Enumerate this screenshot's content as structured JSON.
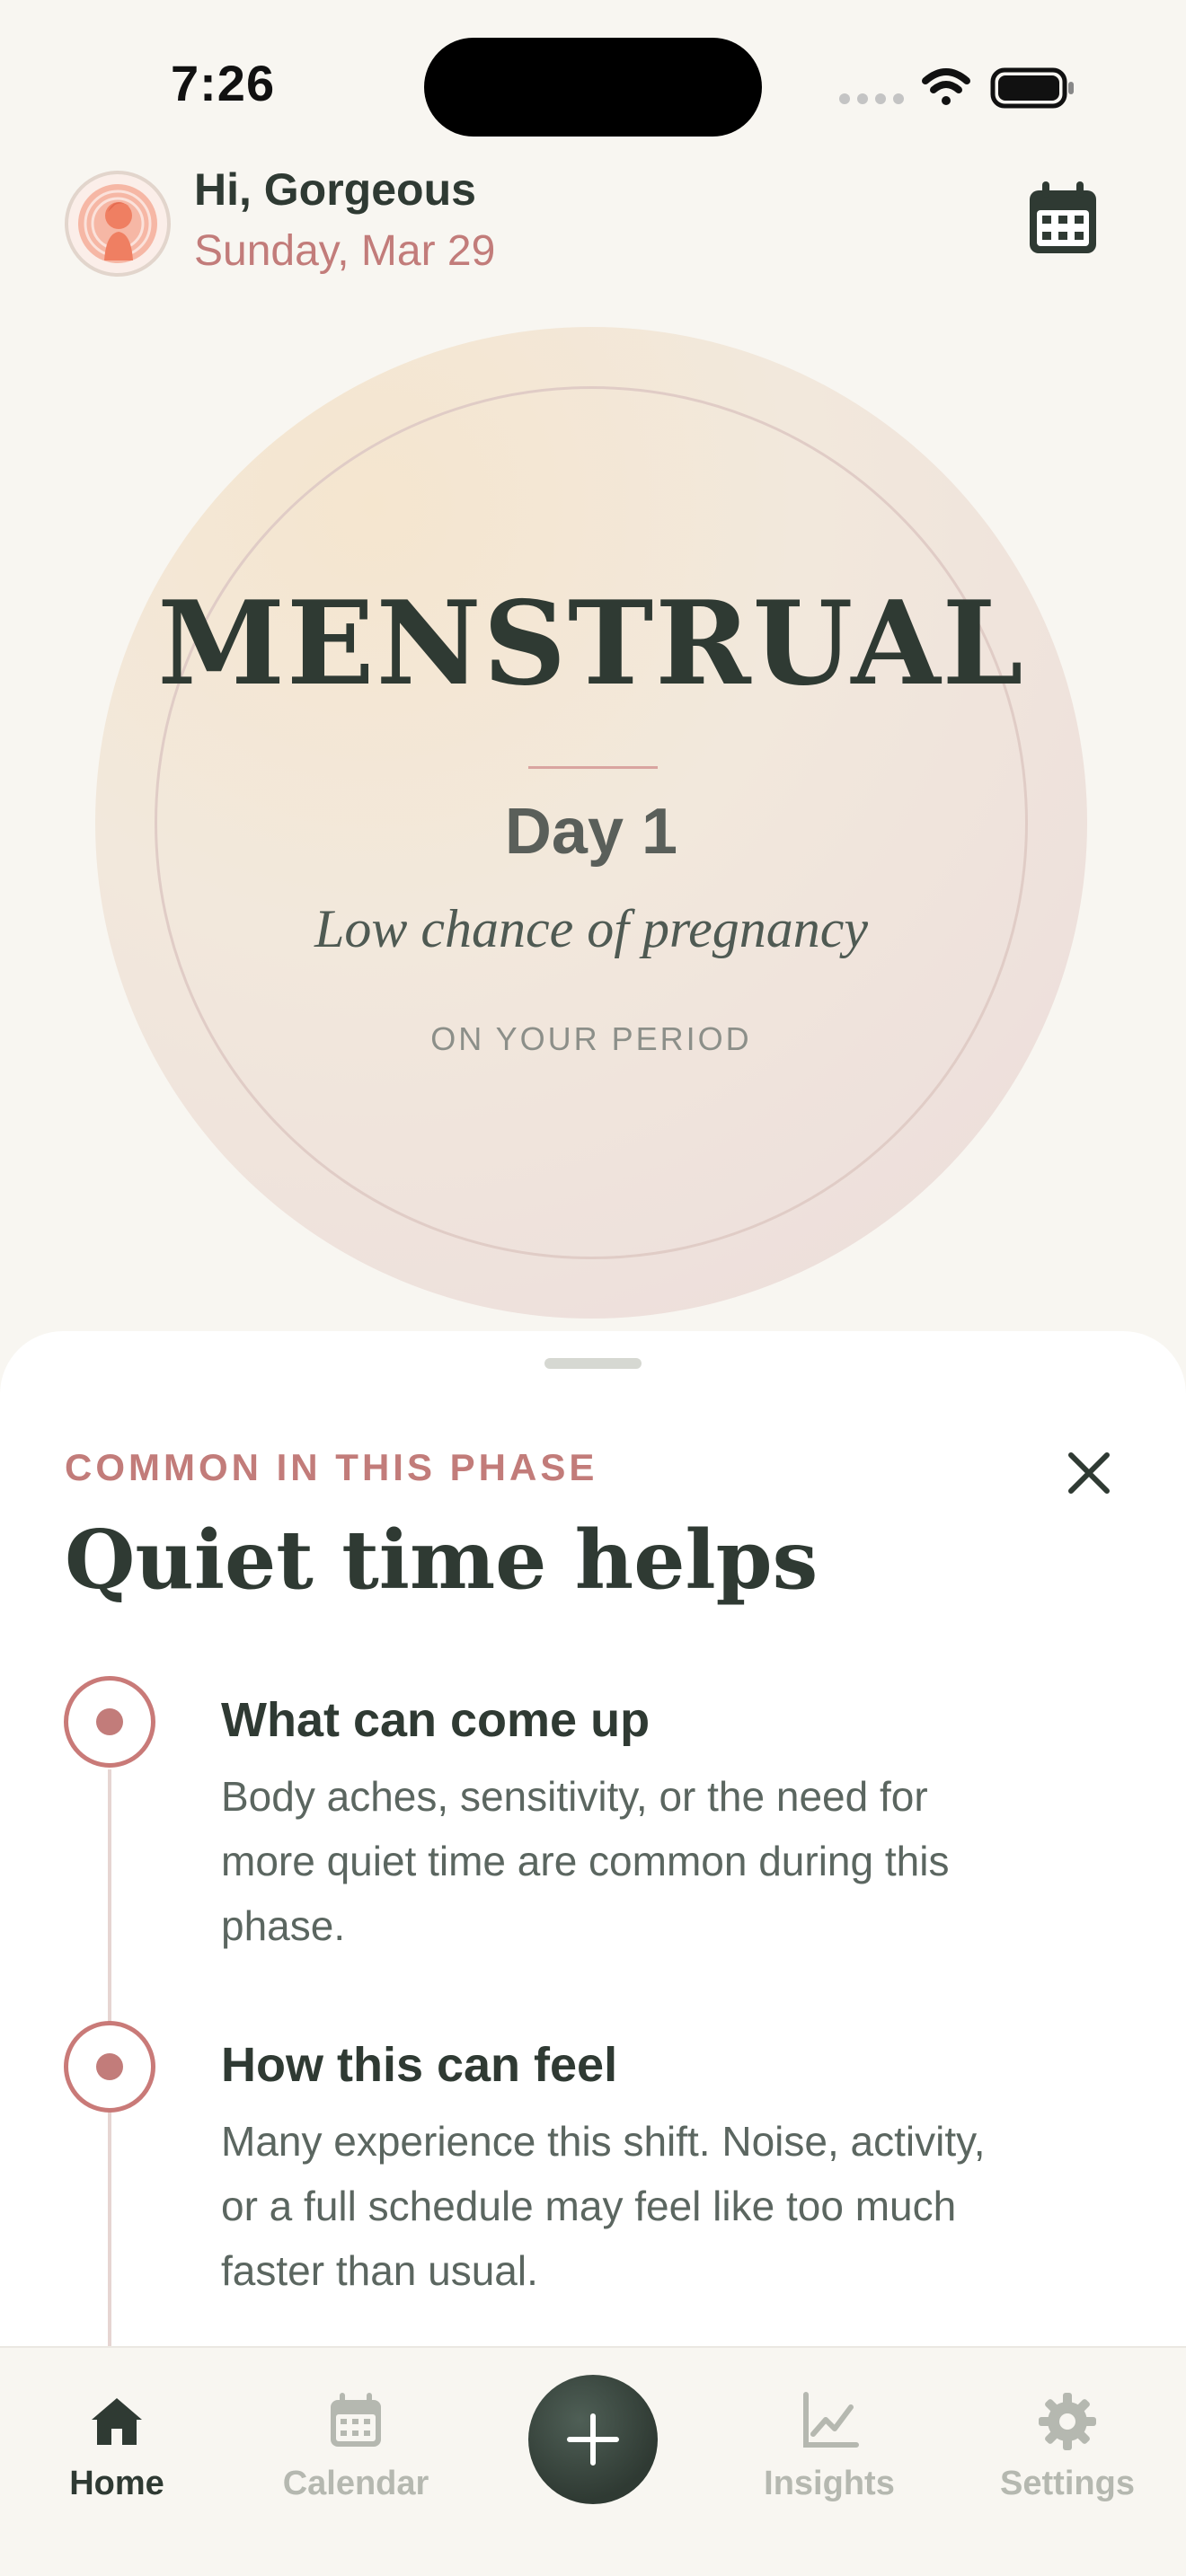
{
  "status_bar": {
    "time": "7:26"
  },
  "header": {
    "greeting": "Hi, Gorgeous",
    "date": "Sunday, Mar 29",
    "avatar_icon": "woman-silhouette-icon",
    "calendar_icon": "calendar-icon"
  },
  "hero": {
    "phase": "MENSTRUAL",
    "day": "Day 1",
    "chance": "Low chance of pregnancy",
    "status": "ON YOUR PERIOD"
  },
  "sheet": {
    "eyebrow": "COMMON IN THIS PHASE",
    "title": "Quiet time helps",
    "close_icon": "close-icon",
    "items": [
      {
        "title": "What can come up",
        "line1": "Body aches, sensitivity, or the need for",
        "line2": "more quiet time are common during this",
        "line3": "phase."
      },
      {
        "title": "How this can feel",
        "line1": "Many experience this shift. Noise, activity,",
        "line2": "or a full schedule may feel like too much",
        "line3": "faster than usual."
      }
    ]
  },
  "tabbar": {
    "home": "Home",
    "calendar": "Calendar",
    "insights": "Insights",
    "settings": "Settings",
    "add_icon": "plus-icon",
    "active": "Home"
  },
  "colors": {
    "accent": "#c27c7a",
    "ink": "#2f3a33",
    "background": "#f8f6f1",
    "muted": "#b5b8b0"
  }
}
